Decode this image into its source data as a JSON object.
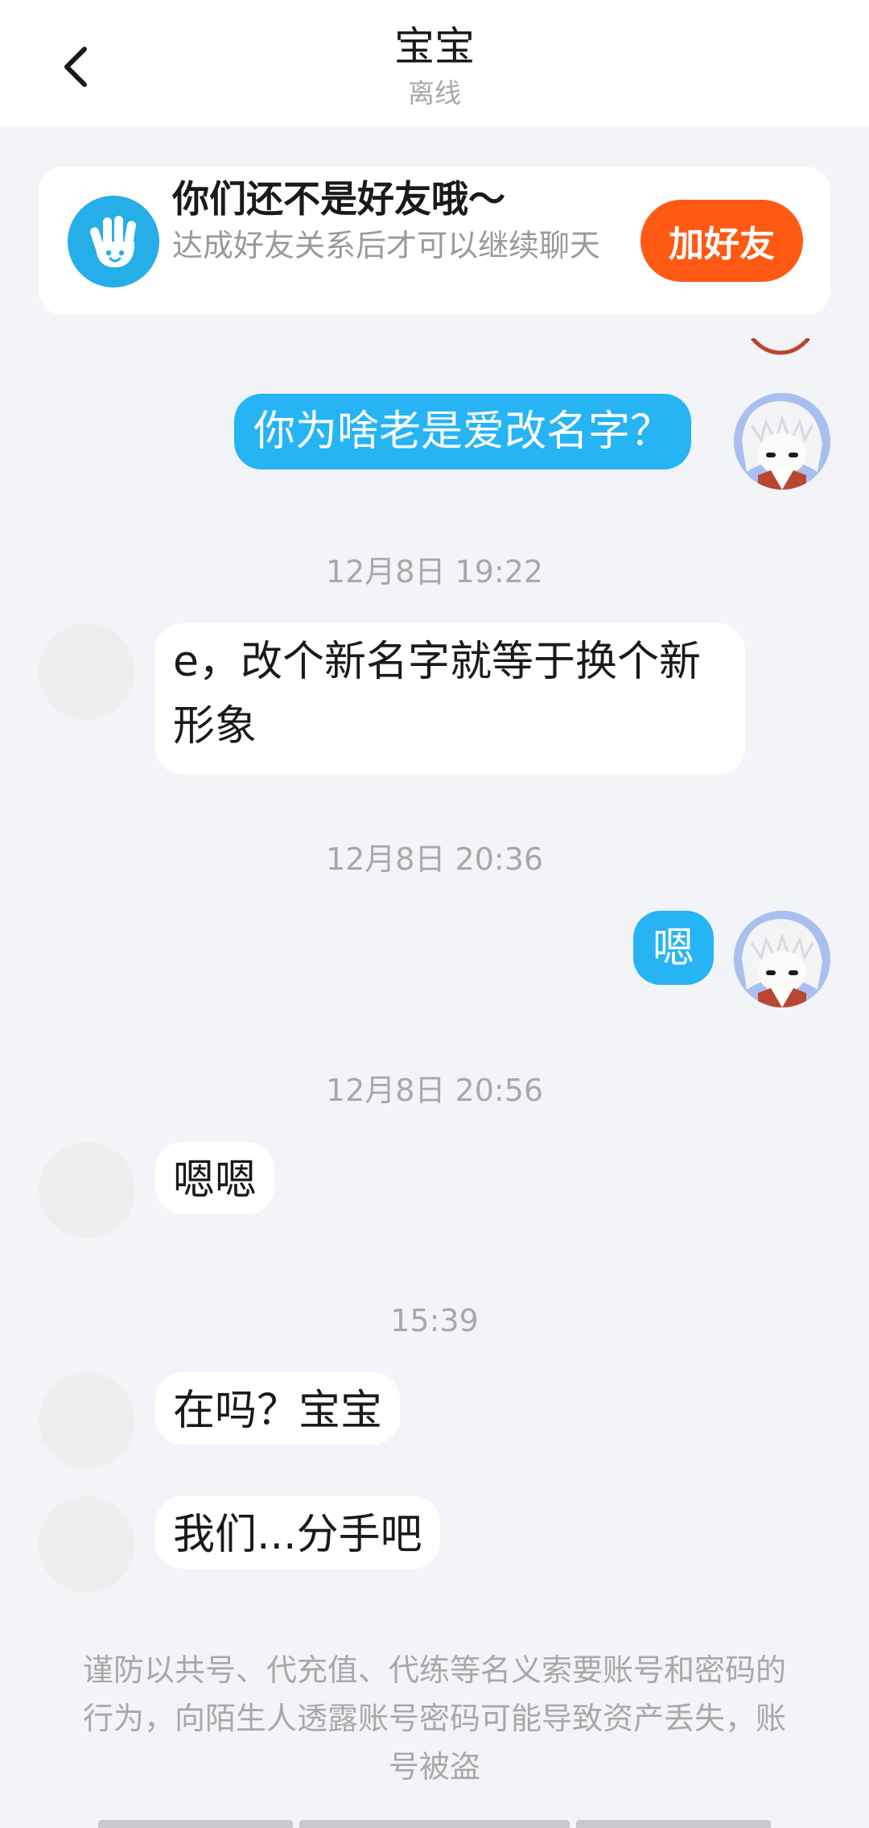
{
  "header": {
    "title": "宝宝",
    "status": "离线"
  },
  "friend_banner": {
    "title": "你们还不是好友哦～",
    "description": "达成好友关系后才可以继续聊天",
    "button_label": "加好友"
  },
  "messages": [
    {
      "sender": "self",
      "text": "你为啥老是爱改名字？"
    },
    {
      "type": "timestamp",
      "text": "12月8日 19:22"
    },
    {
      "sender": "other",
      "text": "e，改个新名字就等于换个新形象"
    },
    {
      "type": "timestamp",
      "text": "12月8日 20:36"
    },
    {
      "sender": "self",
      "text": "嗯"
    },
    {
      "type": "timestamp",
      "text": "12月8日 20:56"
    },
    {
      "sender": "other",
      "text": "嗯嗯"
    },
    {
      "type": "timestamp",
      "text": "15:39"
    },
    {
      "sender": "other",
      "text": "在吗？宝宝"
    },
    {
      "sender": "other",
      "text": "我们...分手吧"
    }
  ],
  "security_notice": "谨防以共号、代充值、代练等名义索要账号和密码的行为，向陌生人透露账号密码可能导致资产丢失，账号被盗",
  "colors": {
    "self_bubble": "#26b4f4",
    "add_friend_button": "#ff5a14",
    "wave_icon_bg": "#25aee8",
    "background": "#f2f4f8"
  }
}
